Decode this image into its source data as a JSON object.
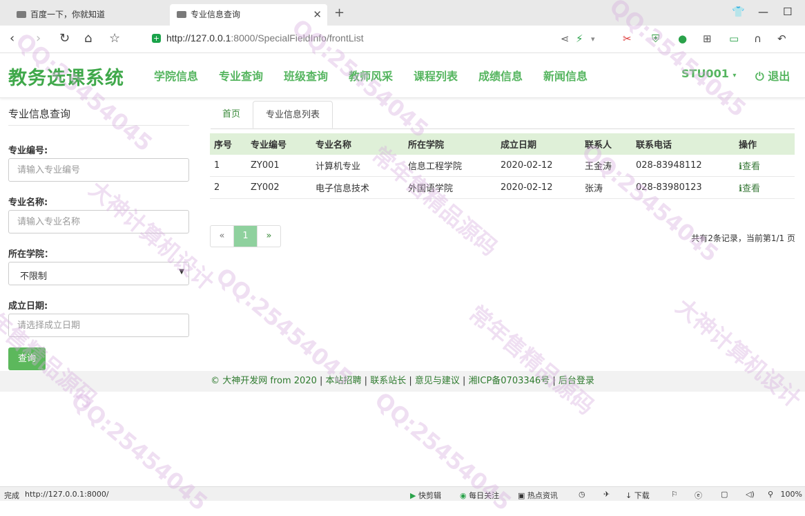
{
  "browser": {
    "tabs": [
      {
        "title": "百度一下，你就知道"
      },
      {
        "title": "专业信息查询"
      }
    ],
    "address": {
      "host": "http://127.0.0.1",
      "rest": ":8000/SpecialFieldInfo/frontList"
    }
  },
  "site": {
    "brand": "教务选课系统",
    "nav": [
      "学院信息",
      "专业查询",
      "班级查询",
      "教师风采",
      "课程列表",
      "成绩信息",
      "新闻信息"
    ],
    "user": "STU001",
    "logout": "退出"
  },
  "sidebar": {
    "title": "专业信息查询",
    "fields": {
      "code": {
        "label": "专业编号:",
        "placeholder": "请输入专业编号"
      },
      "name": {
        "label": "专业名称:",
        "placeholder": "请输入专业名称"
      },
      "college": {
        "label": "所在学院：",
        "value": "不限制"
      },
      "date": {
        "label": "成立日期:",
        "placeholder": "请选择成立日期"
      }
    },
    "query_button": "查询"
  },
  "main": {
    "tabs": [
      "首页",
      "专业信息列表"
    ],
    "table": {
      "headers": [
        "序号",
        "专业编号",
        "专业名称",
        "所在学院",
        "成立日期",
        "联系人",
        "联系电话",
        "操作"
      ],
      "rows": [
        [
          "1",
          "ZY001",
          "计算机专业",
          "信息工程学院",
          "2020-02-12",
          "王金涛",
          "028-83948112",
          "查看"
        ],
        [
          "2",
          "ZY002",
          "电子信息技术",
          "外国语学院",
          "2020-02-12",
          "张涛",
          "028-83980123",
          "查看"
        ]
      ]
    },
    "pager": {
      "prev": "«",
      "current": "1",
      "next": "»"
    },
    "record_info": "共有2条记录，当前第1/1 页"
  },
  "footer": {
    "copyright": "© 大神开发网 from 2020",
    "links": [
      "本站招聘",
      "联系站长",
      "意见与建议",
      "湘ICP备0703346号",
      "后台登录"
    ]
  },
  "statusbar": {
    "status": "完成",
    "url": "http://127.0.0.1:8000/",
    "items": [
      "快剪辑",
      "每日关注",
      "热点资讯",
      "下载"
    ],
    "zoom": "100%"
  },
  "watermarks": [
    "QQ:25454045",
    "大神计算机设计",
    "常年售精品源码"
  ],
  "colors": {
    "brand": "#3fa84a",
    "nav": "#55b55f",
    "table_header": "#dff0d8",
    "button": "#5cb85c",
    "pager_active": "#8fd19e"
  }
}
